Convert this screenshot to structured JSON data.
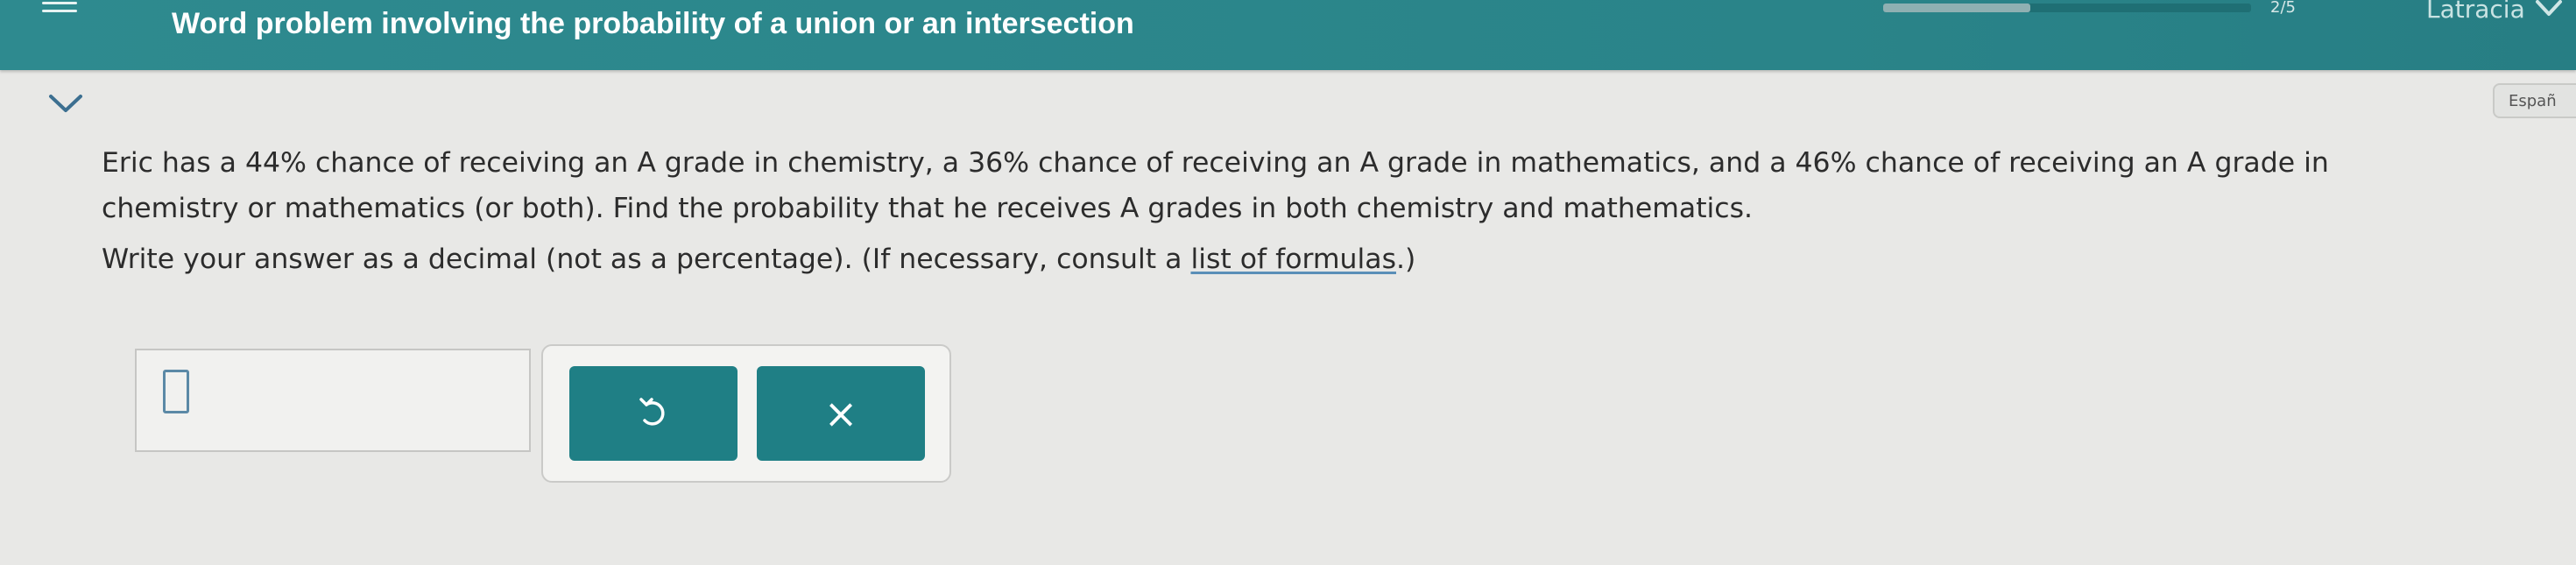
{
  "header": {
    "title": "Word problem involving the probability of a union or an intersection",
    "progress_text": "2/5",
    "progress_fraction": 0.4,
    "language_label": "Latracia",
    "background_color": "#2a8489"
  },
  "controls": {
    "expand_label": "Españ"
  },
  "problem": {
    "line1": "Eric has a 44% chance of receiving an A grade in chemistry, a 36% chance of receiving an A grade in mathematics, and a 46% chance of receiving an A grade in",
    "line2": "chemistry or mathematics (or both). Find the probability that he receives A grades in both chemistry and mathematics.",
    "instructions_prefix": "Write your answer as a decimal (not as a percentage). (If necessary, consult a ",
    "formulas_link": "list of formulas",
    "instructions_suffix": ".)"
  },
  "answer": {
    "value": ""
  },
  "buttons": {
    "undo_icon": "undo-icon",
    "clear_label": "×",
    "color": "#1f7f85"
  }
}
